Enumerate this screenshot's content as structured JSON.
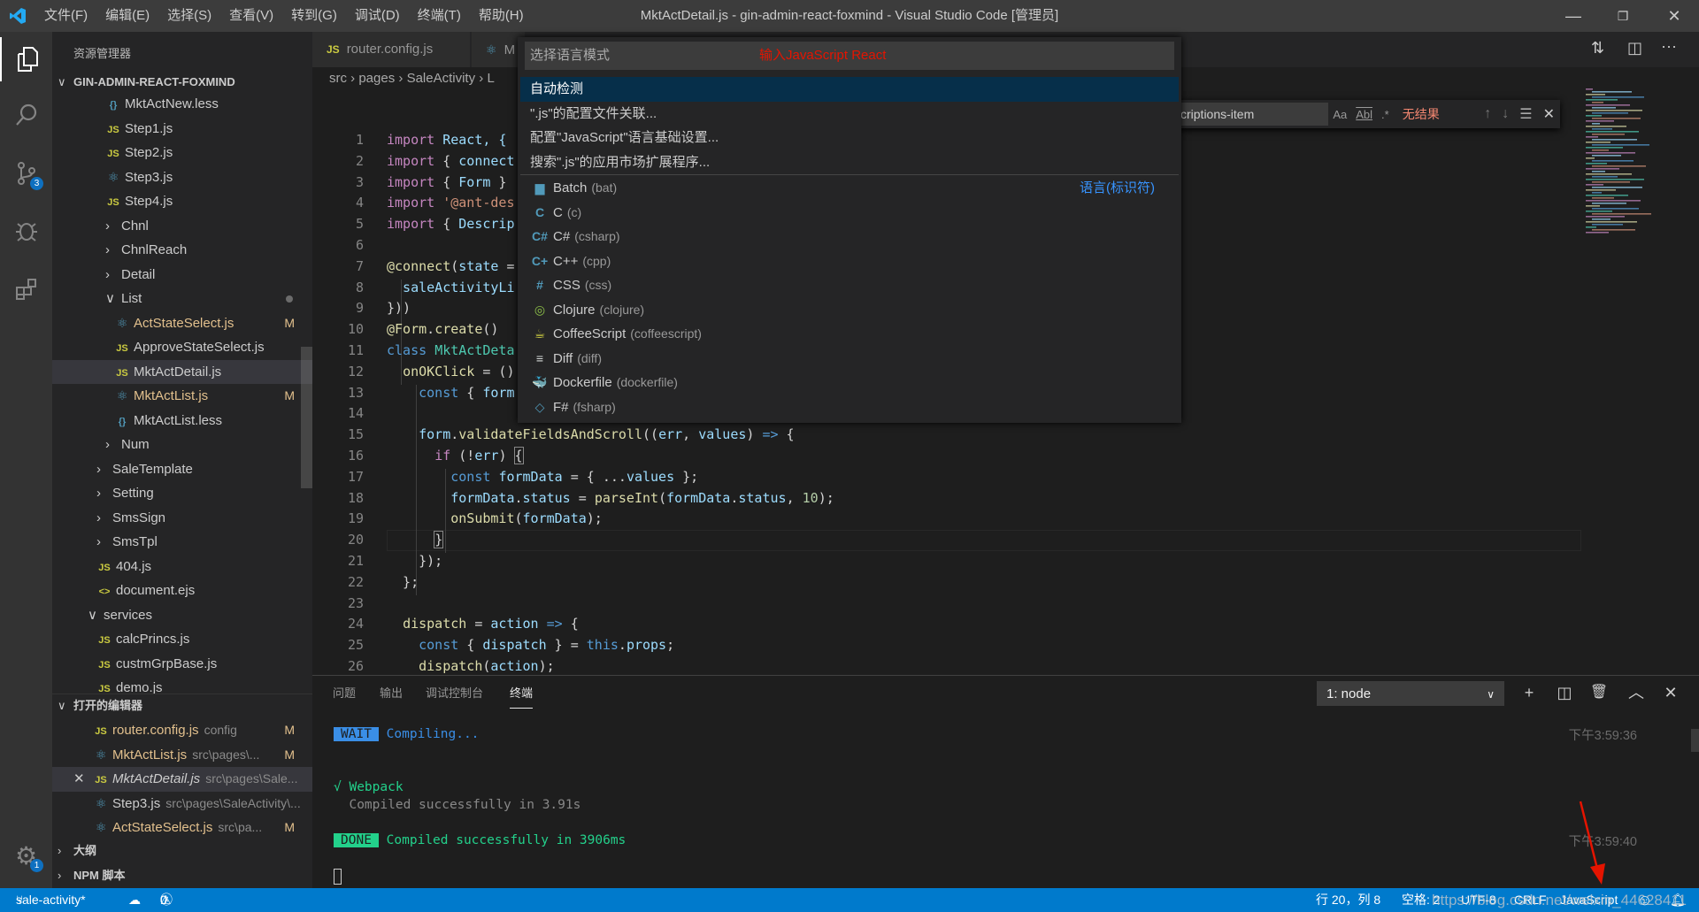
{
  "titlebar": {
    "menu": [
      "文件(F)",
      "编辑(E)",
      "选择(S)",
      "查看(V)",
      "转到(G)",
      "调试(D)",
      "终端(T)",
      "帮助(H)"
    ],
    "title": "MktActDetail.js - gin-admin-react-foxmind - Visual Studio Code [管理员]"
  },
  "activity": {
    "scm_badge": "3",
    "settings_badge": "1"
  },
  "sidebar": {
    "title": "资源管理器",
    "project": "GIN-ADMIN-REACT-FOXMIND",
    "tree": [
      {
        "label": "MktActNew.less",
        "icon": "braces",
        "depth": 4
      },
      {
        "label": "Step1.js",
        "icon": "js",
        "depth": 4
      },
      {
        "label": "Step2.js",
        "icon": "js",
        "depth": 4
      },
      {
        "label": "Step3.js",
        "icon": "react",
        "depth": 4
      },
      {
        "label": "Step4.js",
        "icon": "js",
        "depth": 4
      },
      {
        "label": "Chnl",
        "folder": "closed",
        "depth": 4
      },
      {
        "label": "ChnlReach",
        "folder": "closed",
        "depth": 4
      },
      {
        "label": "Detail",
        "folder": "closed",
        "depth": 4
      },
      {
        "label": "List",
        "folder": "open",
        "depth": 4,
        "dot": true
      },
      {
        "label": "ActStateSelect.js",
        "icon": "react",
        "depth": 5,
        "git": "M"
      },
      {
        "label": "ApproveStateSelect.js",
        "icon": "js",
        "depth": 5
      },
      {
        "label": "MktActDetail.js",
        "icon": "js",
        "depth": 5,
        "selected": true
      },
      {
        "label": "MktActList.js",
        "icon": "react",
        "depth": 5,
        "git": "M"
      },
      {
        "label": "MktActList.less",
        "icon": "braces",
        "depth": 5
      },
      {
        "label": "Num",
        "folder": "closed",
        "depth": 4
      },
      {
        "label": "SaleTemplate",
        "folder": "closed",
        "depth": 3
      },
      {
        "label": "Setting",
        "folder": "closed",
        "depth": 3
      },
      {
        "label": "SmsSign",
        "folder": "closed",
        "depth": 3
      },
      {
        "label": "SmsTpl",
        "folder": "closed",
        "depth": 3
      },
      {
        "label": "404.js",
        "icon": "js",
        "depth": 3
      },
      {
        "label": "document.ejs",
        "icon": "ejs",
        "depth": 3
      },
      {
        "label": "services",
        "folder": "open",
        "depth": 2
      },
      {
        "label": "calcPrincs.js",
        "icon": "js",
        "depth": 3
      },
      {
        "label": "custmGrpBase.js",
        "icon": "js",
        "depth": 3
      },
      {
        "label": "demo.js",
        "icon": "js",
        "depth": 3
      }
    ],
    "open_editors_title": "打开的编辑器",
    "open_editors": [
      {
        "name": "router.config.js",
        "path": "config",
        "icon": "js",
        "git": "M"
      },
      {
        "name": "MktActList.js",
        "path": "src\\pages\\...",
        "icon": "react",
        "git": "M"
      },
      {
        "name": "MktActDetail.js",
        "path": "src\\pages\\Sale...",
        "icon": "js",
        "active": true
      },
      {
        "name": "Step3.js",
        "path": "src\\pages\\SaleActivity\\...",
        "icon": "react"
      },
      {
        "name": "ActStateSelect.js",
        "path": "src\\pa...",
        "icon": "react",
        "git": "M"
      }
    ],
    "outline": "大纲",
    "npm": "NPM 脚本"
  },
  "editor": {
    "tabs": [
      {
        "label": "router.config.js",
        "icon": "js"
      },
      {
        "label": "M",
        "icon": "react"
      }
    ],
    "breadcrumb": [
      "src",
      "pages",
      "SaleActivity",
      "L"
    ],
    "lines": [
      [
        [
          "import",
          "kw"
        ],
        [
          " React, {",
          "va"
        ]
      ],
      [
        [
          "import",
          "kw"
        ],
        [
          " { ",
          "pu"
        ],
        [
          "connect",
          "va"
        ]
      ],
      [
        [
          "import",
          "kw"
        ],
        [
          " { ",
          "pu"
        ],
        [
          "Form",
          "va"
        ],
        [
          " }",
          "pu"
        ]
      ],
      [
        [
          "import",
          "kw"
        ],
        [
          " ",
          "pu"
        ],
        [
          "'@ant-des",
          "str"
        ]
      ],
      [
        [
          "import",
          "kw"
        ],
        [
          " { ",
          "pu"
        ],
        [
          "Descrip",
          "va"
        ]
      ],
      [],
      [
        [
          "@connect",
          "fn"
        ],
        [
          "(",
          "pu"
        ],
        [
          "state",
          "va"
        ],
        [
          " =",
          "pu"
        ]
      ],
      [
        [
          "  saleActivityLi",
          "va"
        ]
      ],
      [
        [
          "}))",
          "pu"
        ]
      ],
      [
        [
          "@Form",
          "fn"
        ],
        [
          ".",
          "pu"
        ],
        [
          "create",
          "fn"
        ],
        [
          "()",
          "pu"
        ]
      ],
      [
        [
          "class",
          "st"
        ],
        [
          " ",
          "pu"
        ],
        [
          "MktActDeta",
          "ty"
        ]
      ],
      [
        [
          "  ",
          "pu"
        ],
        [
          "onOKClick",
          "fn"
        ],
        [
          " = ()",
          "pu"
        ]
      ],
      [
        [
          "    ",
          "pu"
        ],
        [
          "const",
          "st"
        ],
        [
          " { ",
          "pu"
        ],
        [
          "form",
          "va"
        ]
      ],
      [],
      [
        [
          "    ",
          "pu"
        ],
        [
          "form",
          "va"
        ],
        [
          ".",
          "pu"
        ],
        [
          "validateFieldsAndScroll",
          "fn"
        ],
        [
          "((",
          "pu"
        ],
        [
          "err",
          "va"
        ],
        [
          ", ",
          "pu"
        ],
        [
          "values",
          "va"
        ],
        [
          ") ",
          "pu"
        ],
        [
          "=>",
          "st"
        ],
        [
          " {",
          "pu"
        ]
      ],
      [
        [
          "      ",
          "pu"
        ],
        [
          "if",
          "kw"
        ],
        [
          " (!",
          "pu"
        ],
        [
          "err",
          "va"
        ],
        [
          ") ",
          "pu"
        ],
        [
          "{",
          "pu bm"
        ]
      ],
      [
        [
          "        ",
          "pu"
        ],
        [
          "const",
          "st"
        ],
        [
          " ",
          "pu"
        ],
        [
          "formData",
          "va"
        ],
        [
          " = { ...",
          "pu"
        ],
        [
          "values",
          "va"
        ],
        [
          " };",
          "pu"
        ]
      ],
      [
        [
          "        ",
          "pu"
        ],
        [
          "formData",
          "va"
        ],
        [
          ".",
          "pu"
        ],
        [
          "status",
          "va"
        ],
        [
          " = ",
          "pu"
        ],
        [
          "parseInt",
          "fn"
        ],
        [
          "(",
          "pu"
        ],
        [
          "formData",
          "va"
        ],
        [
          ".",
          "pu"
        ],
        [
          "status",
          "va"
        ],
        [
          ", ",
          "pu"
        ],
        [
          "10",
          "num"
        ],
        [
          ");",
          "pu"
        ]
      ],
      [
        [
          "        ",
          "pu"
        ],
        [
          "onSubmit",
          "fn"
        ],
        [
          "(",
          "pu"
        ],
        [
          "formData",
          "va"
        ],
        [
          ");",
          "pu"
        ]
      ],
      [
        [
          "      ",
          "pu"
        ],
        [
          "}",
          "pu bm"
        ]
      ],
      [
        [
          "    });",
          "pu"
        ]
      ],
      [
        [
          "  };",
          "pu"
        ]
      ],
      [],
      [
        [
          "  ",
          "pu"
        ],
        [
          "dispatch",
          "fn"
        ],
        [
          " = ",
          "pu"
        ],
        [
          "action",
          "va"
        ],
        [
          " ",
          "pu"
        ],
        [
          "=>",
          "st"
        ],
        [
          " {",
          "pu"
        ]
      ],
      [
        [
          "    ",
          "pu"
        ],
        [
          "const",
          "st"
        ],
        [
          " { ",
          "pu"
        ],
        [
          "dispatch",
          "va"
        ],
        [
          " } = ",
          "pu"
        ],
        [
          "this",
          "st"
        ],
        [
          ".",
          "pu"
        ],
        [
          "props",
          "va"
        ],
        [
          ";",
          "pu"
        ]
      ],
      [
        [
          "    ",
          "pu"
        ],
        [
          "dispatch",
          "fn"
        ],
        [
          "(",
          "pu"
        ],
        [
          "action",
          "va"
        ],
        [
          ");",
          "pu"
        ]
      ]
    ],
    "current_line": 20
  },
  "find": {
    "value": "criptions-item",
    "case": "Aa",
    "word": "Abl",
    "regex": ".*",
    "result": "无结果"
  },
  "quickpick": {
    "placeholder": "选择语言模式",
    "annotation": "输入JavaScript React",
    "actions": [
      "自动检测",
      "\".js\"的配置文件关联...",
      "配置\"JavaScript\"语言基础设置...",
      "搜索\".js\"的应用市场扩展程序..."
    ],
    "group_label": "语言(标识符)",
    "languages": [
      {
        "name": "Batch",
        "id": "(bat)",
        "icon": "▆",
        "color": "#519aba"
      },
      {
        "name": "C",
        "id": "(c)",
        "icon": "C",
        "color": "#519aba"
      },
      {
        "name": "C#",
        "id": "(csharp)",
        "icon": "C#",
        "color": "#519aba"
      },
      {
        "name": "C++",
        "id": "(cpp)",
        "icon": "C+",
        "color": "#519aba"
      },
      {
        "name": "CSS",
        "id": "(css)",
        "icon": "#",
        "color": "#519aba"
      },
      {
        "name": "Clojure",
        "id": "(clojure)",
        "icon": "◎",
        "color": "#8dc149"
      },
      {
        "name": "CoffeeScript",
        "id": "(coffeescript)",
        "icon": "☕",
        "color": "#cbcb41"
      },
      {
        "name": "Diff",
        "id": "(diff)",
        "icon": "≡",
        "color": "#d4d7d6"
      },
      {
        "name": "Dockerfile",
        "id": "(dockerfile)",
        "icon": "🐳",
        "color": "#519aba"
      },
      {
        "name": "F#",
        "id": "(fsharp)",
        "icon": "◇",
        "color": "#519aba"
      }
    ]
  },
  "panel": {
    "tabs": [
      "问题",
      "输出",
      "调试控制台",
      "终端"
    ],
    "active_tab": "终端",
    "terminal_select": "1: node",
    "terminal": {
      "wait_badge": "WAIT",
      "wait_text": "Compiling...",
      "wait_time": "下午3:59:36",
      "webpack_line": "√ Webpack",
      "compiled_line": "  Compiled successfully in 3.91s",
      "done_badge": "DONE",
      "done_text": "Compiled successfully in 3906ms",
      "done_time": "下午3:59:40"
    }
  },
  "statusbar": {
    "branch": "sale-activity*",
    "errors": "0",
    "warnings": "0",
    "position": "行 20，列 8",
    "spaces": "空格: 2",
    "encoding": "UTF-8",
    "eol": "CRLF",
    "language": "JavaScript"
  },
  "watermark": "https://blog.csdn.net/weixin_44628411",
  "colors": {
    "statusbar": "#007acc",
    "selection": "#062f4a",
    "annotation": "#e51400"
  }
}
